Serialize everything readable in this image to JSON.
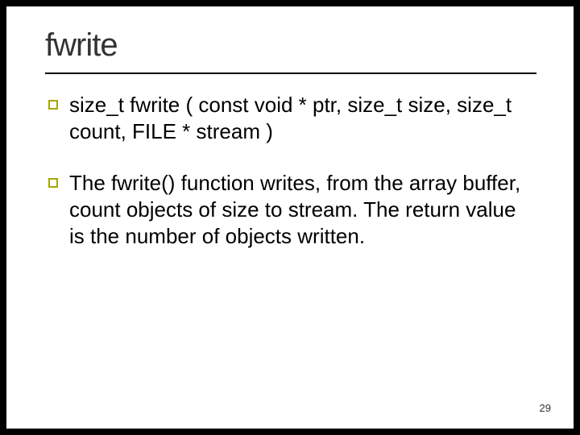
{
  "slide": {
    "title": "fwrite",
    "bullets": [
      "size_t fwrite ( const void * ptr, size_t size, size_t count, FILE * stream )",
      "The fwrite() function writes, from the array buffer, count objects of size to stream. The return value is the number of objects         written."
    ],
    "page_number": "29",
    "accent_color": "#a6a600"
  }
}
